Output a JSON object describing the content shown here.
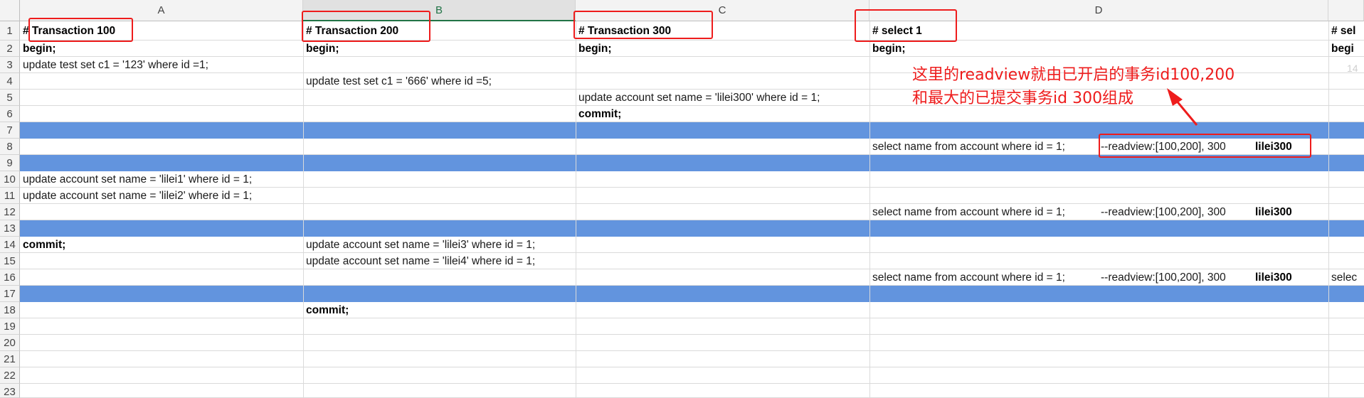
{
  "columns": [
    "A",
    "B",
    "C",
    "D"
  ],
  "rows": [
    "1",
    "2",
    "3",
    "4",
    "5",
    "6",
    "7",
    "8",
    "9",
    "10",
    "11",
    "12",
    "13",
    "14",
    "15",
    "16",
    "17",
    "18",
    "19",
    "20",
    "21",
    "22",
    "23"
  ],
  "cells": {
    "a1": "# Transaction 100",
    "b1": "# Transaction 200",
    "c1": "# Transaction 300",
    "d1": "# select 1",
    "e1": "# sel",
    "a2": "begin;",
    "b2": "begin;",
    "c2": "begin;",
    "d2": "begin;",
    "e2": "begi",
    "a3": "update test set c1 = '123' where id =1;",
    "b4": "update test set c1 = '666' where id =5;",
    "c5": "update account set name = 'lilei300' where id = 1;",
    "c6": "commit;",
    "d8": "select name from account where id = 1;",
    "d8_rv": "--readview:[100,200], 300",
    "d8_res": "lilei300",
    "a10": "update account set name = 'lilei1' where id = 1;",
    "a11": "update account set name = 'lilei2' where id = 1;",
    "d12": "select name from account where id = 1;",
    "d12_rv": "--readview:[100,200], 300",
    "d12_res": "lilei300",
    "a14": "commit;",
    "b14": "update account set name = 'lilei3' where id = 1;",
    "b15": "update account set name = 'lilei4' where id = 1;",
    "d16": "select name from account where id = 1;",
    "d16_rv": "--readview:[100,200], 300",
    "d16_res": "lilei300",
    "e16": "selec",
    "b18": "commit;"
  },
  "annotation": {
    "line1": "这里的readview就由已开启的事务id100,200",
    "line2": "和最大的已提交事务id 300组成"
  },
  "page_fragment": "14",
  "colors": {
    "highlight_row": "#6294de",
    "annotation": "#ee1c1c",
    "selected_column": "#217346"
  }
}
